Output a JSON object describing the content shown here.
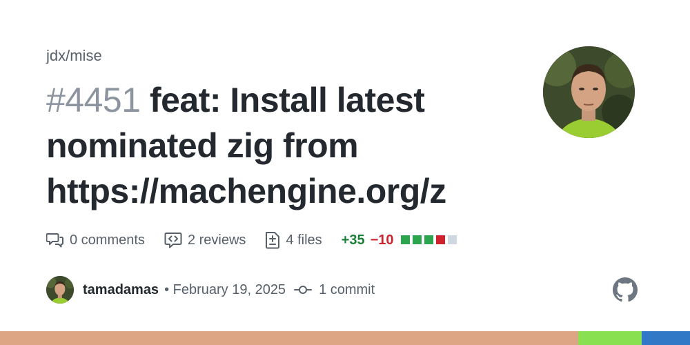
{
  "repo": "jdx/mise",
  "pr": {
    "number": "#4451",
    "title": "feat: Install latest nominated zig from https://machengine.org/z"
  },
  "stats": {
    "comments": "0 comments",
    "reviews": "2 reviews",
    "files": "4 files",
    "additions": "+35",
    "deletions": "−10",
    "diff_squares": [
      "#2da44e",
      "#2da44e",
      "#2da44e",
      "#cf222e",
      "#d0d7de"
    ]
  },
  "author": {
    "name": "tamadamas",
    "date": "• February 19, 2025",
    "commits": "1 commit"
  },
  "icons": {
    "comments": "comment-discussion-icon",
    "reviews": "code-review-icon",
    "files": "file-diff-icon",
    "commit": "git-commit-icon",
    "brand": "github-mark-icon"
  },
  "language_bar": [
    {
      "color": "#dea584",
      "fraction": 0.838
    },
    {
      "color": "#89e051",
      "fraction": 0.092
    },
    {
      "color": "#3178c6",
      "fraction": 0.07
    }
  ]
}
